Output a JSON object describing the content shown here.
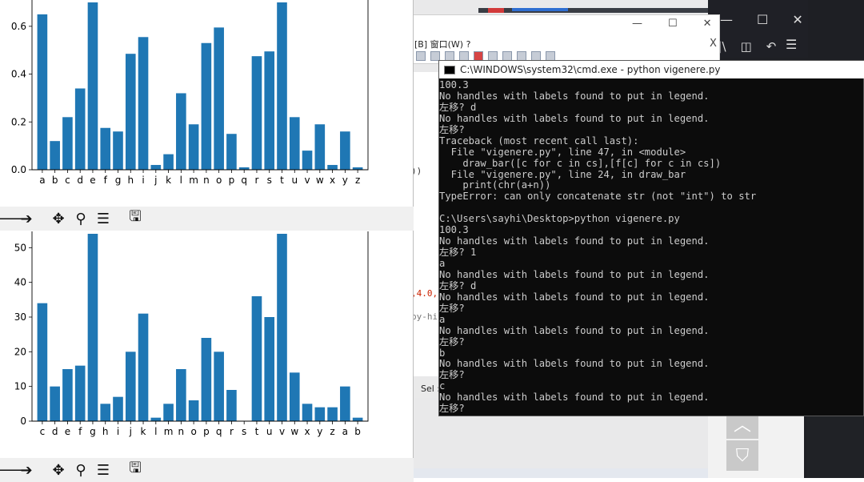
{
  "colors": {
    "bar": "#1f77b4",
    "cmd_bg": "#0c0c0c",
    "cmd_text": "#cccccc"
  },
  "dialog": {
    "menu_text": "[B]  窗口(W)  ?",
    "close_label": "X",
    "controls": {
      "minimize": "—",
      "maximize": "☐",
      "close": "✕"
    }
  },
  "editor": {
    "fragment_1": "))",
    "fragment_2": ",4.0,",
    "fragment_3": "py-hi",
    "sel_label": "Sel :"
  },
  "cmd": {
    "title": "C:\\WINDOWS\\system32\\cmd.exe - python  vigenere.py",
    "lines": [
      "100.3",
      "No handles with labels found to put in legend.",
      "左移? d",
      "No handles with labels found to put in legend.",
      "左移?",
      "Traceback (most recent call last):",
      "  File \"vigenere.py\", line 47, in <module>",
      "    draw_bar([c for c in cs],[f[c] for c in cs])",
      "  File \"vigenere.py\", line 24, in draw_bar",
      "    print(chr(a+n))",
      "TypeError: can only concatenate str (not \"int\") to str",
      "",
      "C:\\Users\\sayhi\\Desktop>python vigenere.py",
      "100.3",
      "No handles with labels found to put in legend.",
      "左移? 1",
      "a",
      "No handles with labels found to put in legend.",
      "左移? d",
      "No handles with labels found to put in legend.",
      "左移?",
      "a",
      "No handles with labels found to put in legend.",
      "左移?",
      "b",
      "No handles with labels found to put in legend.",
      "左移?",
      "c",
      "No handles with labels found to put in legend.",
      "左移?"
    ]
  },
  "toolbar_icons": [
    "back-arrow-icon",
    "forward-arrow-icon",
    "pan-icon",
    "zoom-icon",
    "configure-subplots-icon",
    "save-icon"
  ],
  "chart_data": [
    {
      "type": "bar",
      "categories": [
        "a",
        "b",
        "c",
        "d",
        "e",
        "f",
        "g",
        "h",
        "i",
        "j",
        "k",
        "l",
        "m",
        "n",
        "o",
        "p",
        "q",
        "r",
        "s",
        "t",
        "u",
        "v",
        "w",
        "x",
        "y",
        "z"
      ],
      "values": [
        0.65,
        0.12,
        0.22,
        0.34,
        0.7,
        0.175,
        0.16,
        0.485,
        0.555,
        0.02,
        0.065,
        0.32,
        0.19,
        0.53,
        0.595,
        0.15,
        0.01,
        0.475,
        0.495,
        0.7,
        0.22,
        0.08,
        0.19,
        0.02,
        0.16,
        0.01
      ],
      "yticks": [
        "0.0",
        "0.2",
        "0.4",
        "0.6"
      ],
      "ylim": [
        0,
        0.7
      ]
    },
    {
      "type": "bar",
      "categories": [
        "c",
        "d",
        "e",
        "f",
        "g",
        "h",
        "i",
        "j",
        "k",
        "l",
        "m",
        "n",
        "o",
        "p",
        "q",
        "r",
        "s",
        "t",
        "u",
        "v",
        "w",
        "x",
        "y",
        "z",
        "a",
        "b"
      ],
      "values": [
        34,
        10,
        15,
        16,
        54,
        5,
        7,
        20,
        31,
        1,
        5,
        15,
        6,
        24,
        20,
        9,
        0,
        36,
        30,
        54,
        14,
        5,
        4,
        4,
        10,
        1
      ],
      "yticks": [
        "0",
        "10",
        "20",
        "30",
        "40",
        "50"
      ],
      "ylim": [
        0,
        54
      ]
    }
  ]
}
